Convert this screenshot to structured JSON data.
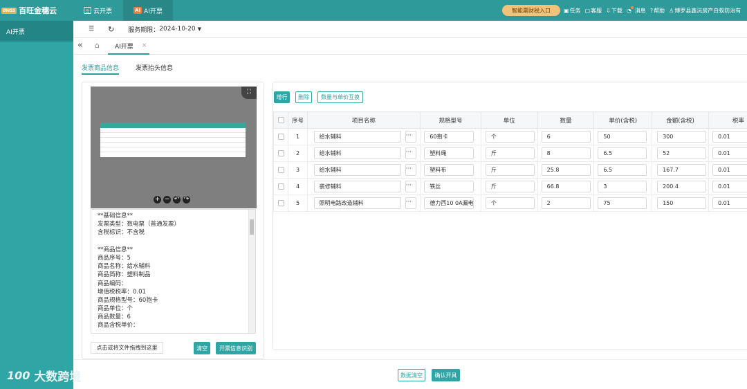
{
  "app": {
    "logo_mark": "BWSS",
    "logo_text": "百旺金穗云"
  },
  "top_tabs": [
    {
      "label": "云开票",
      "icon": "invoice-icon"
    },
    {
      "label": "AI开票",
      "icon": "ai-icon",
      "icon_text": "AI"
    }
  ],
  "header": {
    "portal": "智能票财税入口",
    "links": [
      {
        "icon": "clipboard-icon",
        "glyph": "▣",
        "label": "任务"
      },
      {
        "icon": "chat-icon",
        "glyph": "▢",
        "label": "客服"
      },
      {
        "icon": "download-icon",
        "glyph": "⇩",
        "label": "下载"
      },
      {
        "icon": "bell-icon",
        "glyph": "◔",
        "label": "消息"
      },
      {
        "icon": "help-icon",
        "glyph": "?",
        "label": "帮助"
      },
      {
        "icon": "user-icon",
        "glyph": "♙",
        "label": "博罗县鑫沅房产白蚁防治有"
      }
    ]
  },
  "sidebar": {
    "items": [
      {
        "label": "AI开票"
      }
    ]
  },
  "toolbar": {
    "menu_icon": "☰",
    "refresh_icon": "↻",
    "service_label": "服务期限：",
    "service_date": "2024-10-20"
  },
  "breadcrumb": {
    "collapse_icon": "«",
    "home_icon": "⌂",
    "tab_label": "AI开票",
    "close_icon": "×"
  },
  "sections": [
    {
      "label": "发票商品信息"
    },
    {
      "label": "发票抬头信息"
    }
  ],
  "preview": {
    "fullscreen_icon": "⛶",
    "controls": [
      "+",
      "−",
      "↶",
      "↷"
    ]
  },
  "parsed_text": [
    "**基础信息**",
    "发票类型：数电票（普通发票）",
    "含税标识：不含税",
    "",
    "**商品信息**",
    "商品序号：5",
    "商品名称：给水辅料",
    "商品简称：塑料制品",
    "商品编码：",
    "增值税税率：0.01",
    "商品规格型号：60抱卡",
    "商品单位：个",
    "商品数量：6",
    "商品含税单价："
  ],
  "left_actions": {
    "drop": "点击或将文件拖拽到这里",
    "clear": "清空",
    "recognize": "开票信息识别"
  },
  "right_actions": {
    "add_row": "增行",
    "delete": "删除",
    "swap": "数量与单价互换"
  },
  "table": {
    "columns": [
      "序号",
      "项目名称",
      "规格型号",
      "单位",
      "数量",
      "单价(含税)",
      "金额(含税)",
      "税率"
    ],
    "rows": [
      {
        "no": "1",
        "name": "给水辅料",
        "spec": "60抱卡",
        "unit": "个",
        "qty": "6",
        "price": "50",
        "amount": "300",
        "rate": "0.01"
      },
      {
        "no": "2",
        "name": "给水辅料",
        "spec": "塑料绳",
        "unit": "斤",
        "qty": "8",
        "price": "6.5",
        "amount": "52",
        "rate": "0.01"
      },
      {
        "no": "3",
        "name": "给水辅料",
        "spec": "塑料布",
        "unit": "斤",
        "qty": "25.8",
        "price": "6.5",
        "amount": "167.7",
        "rate": "0.01"
      },
      {
        "no": "4",
        "name": "装修辅料",
        "spec": "铁丝",
        "unit": "斤",
        "qty": "66.8",
        "price": "3",
        "amount": "200.4",
        "rate": "0.01"
      },
      {
        "no": "5",
        "name": "照明电路改造辅料",
        "spec": "德力西10 0A漏电",
        "unit": "个",
        "qty": "2",
        "price": "75",
        "amount": "150",
        "rate": "0.01"
      }
    ]
  },
  "footer": {
    "reset": "数据清空",
    "confirm": "确认开具"
  },
  "watermark": {
    "icon": "100",
    "text": "大数跨境"
  },
  "colors": {
    "primary": "#2f9a9a",
    "sidebar": "#2fa5a5",
    "portal": "#f2c27a",
    "ai_badge": "#f07f3c"
  }
}
